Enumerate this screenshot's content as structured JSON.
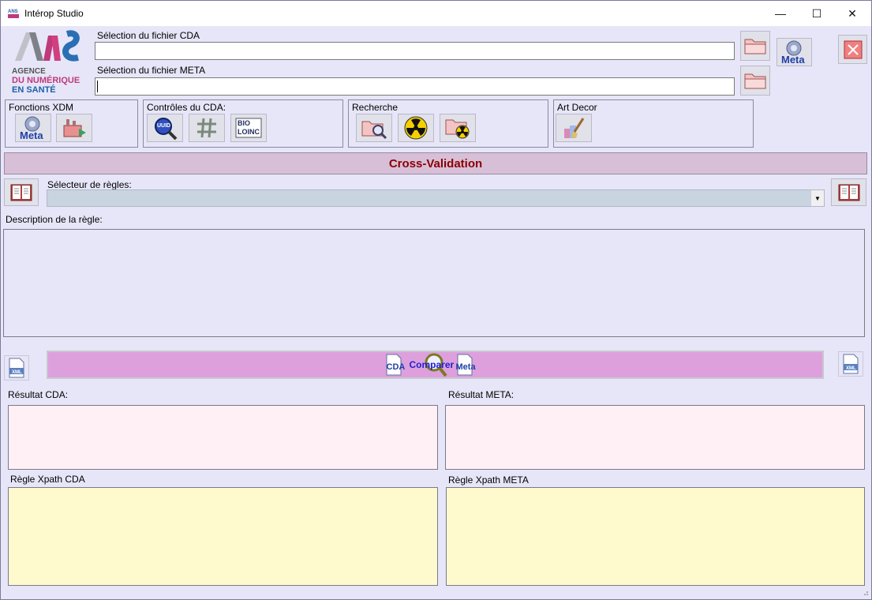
{
  "window": {
    "title": "Intérop Studio",
    "minimize": "—",
    "maximize": "☐",
    "close": "✕"
  },
  "logo": {
    "line1": "AGENCE",
    "line2": "DU NUMÉRIQUE",
    "line3": "EN SANTÉ"
  },
  "files": {
    "cda_label": "Sélection du fichier CDA",
    "cda_value": "",
    "meta_label": "Sélection du fichier META",
    "meta_value": ""
  },
  "toolbar": {
    "meta_button": "Meta"
  },
  "groups": {
    "xdm": {
      "title": "Fonctions XDM",
      "meta_icon_text": "Meta"
    },
    "cda": {
      "title": "Contrôles du CDA:",
      "uuid_text": "UUID",
      "bio_text": "BIO",
      "loinc_text": "LOINC"
    },
    "search": {
      "title": "Recherche"
    },
    "artdecor": {
      "title": "Art Decor"
    }
  },
  "cross_validation": {
    "banner": "Cross-Validation",
    "rules_selector_label": "Sélecteur de règles:",
    "rules_selected": "",
    "description_label": "Description de la règle:",
    "description_value": ""
  },
  "compare": {
    "cda_text": "CDA",
    "label": "Comparer",
    "meta_text": "Meta",
    "xml_text": "XML"
  },
  "results": {
    "cda_label": "Résultat CDA:",
    "meta_label": "Résultat META:",
    "xpath_cda_label": "Règle Xpath CDA",
    "xpath_meta_label": "Règle Xpath META"
  },
  "colors": {
    "background": "#e6e6f8",
    "banner": "#d8bfd8",
    "banner_text": "#8b0000",
    "compare_button": "#dda0dd",
    "result_pink": "#fff0f5",
    "xpath_yellow": "#fffacd",
    "combo": "#c8d4e0"
  }
}
